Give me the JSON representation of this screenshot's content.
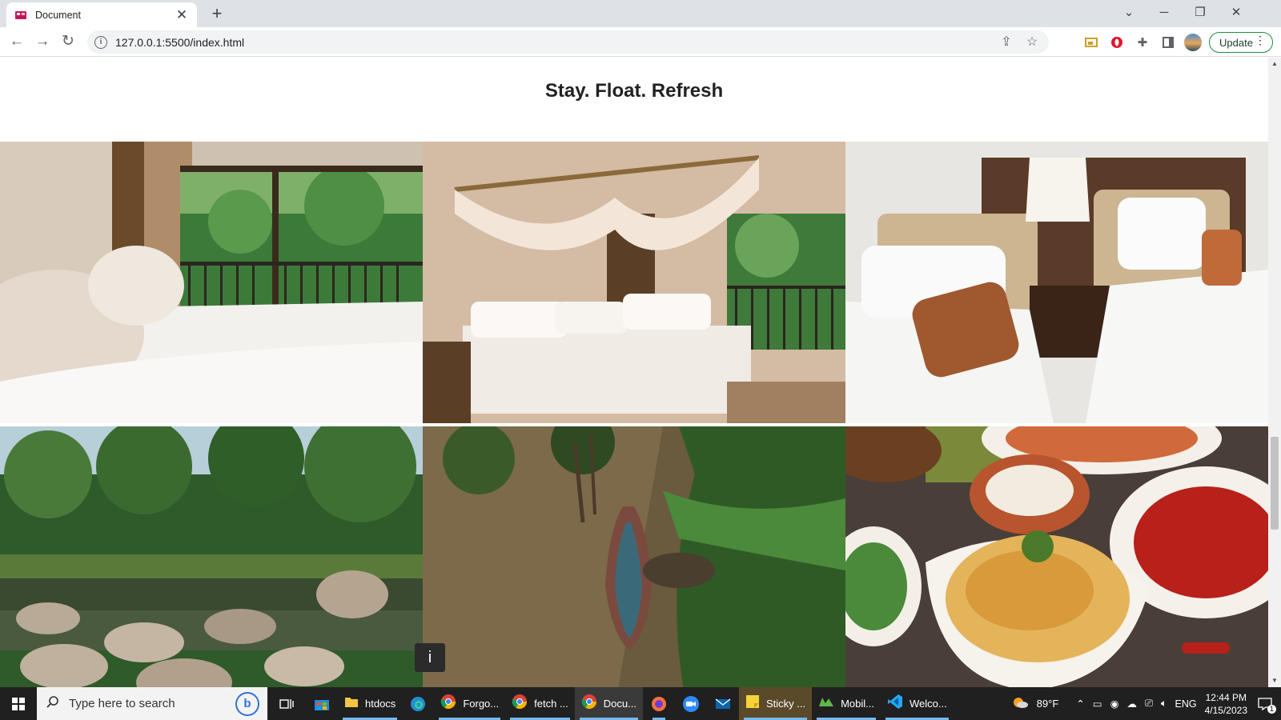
{
  "browser": {
    "tab": {
      "title": "Document",
      "favicon": "page-icon"
    },
    "url": "127.0.0.1:5500/index.html",
    "update_label": "Update"
  },
  "page": {
    "headline": "Stay. Float. Refresh",
    "gallery": [
      {
        "subject": "bedroom with jungle balcony view"
      },
      {
        "subject": "canopy bed with balcony"
      },
      {
        "subject": "hotel twin beds with orange cushions"
      },
      {
        "subject": "forest river with rocks"
      },
      {
        "subject": "wooden canoe on backwater"
      },
      {
        "subject": "biryani and curry dishes"
      }
    ],
    "tooltip_text": "i"
  },
  "taskbar": {
    "search_placeholder": "Type here to search",
    "apps": [
      {
        "label": "htdocs",
        "icon": "folder-icon"
      },
      {
        "label": "Forgo...",
        "icon": "chrome-icon"
      },
      {
        "label": "fetch ...",
        "icon": "chrome-icon"
      },
      {
        "label": "Docu...",
        "icon": "chrome-icon"
      },
      {
        "label": "Sticky ...",
        "icon": "sticky-notes-icon"
      },
      {
        "label": "Mobil...",
        "icon": "app-icon"
      },
      {
        "label": "Welco...",
        "icon": "vscode-icon"
      }
    ],
    "weather": "89°F",
    "language": "ENG",
    "time": "12:44 PM",
    "date": "4/15/2023",
    "notification_count": "1"
  }
}
